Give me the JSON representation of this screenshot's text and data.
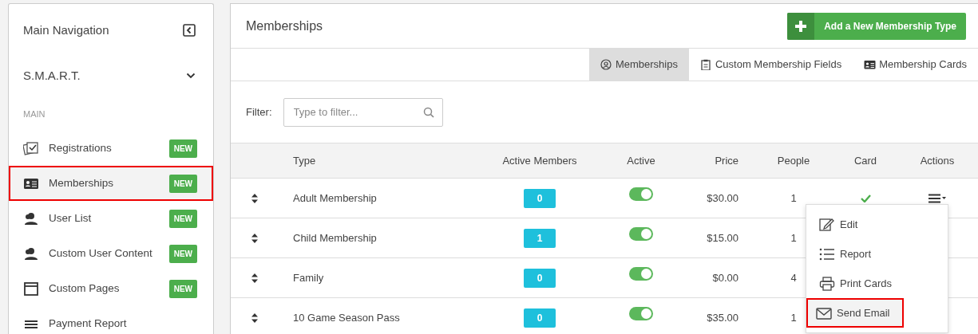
{
  "sidebar": {
    "title": "Main Navigation",
    "organization": "S.M.A.R.T.",
    "section_label": "MAIN",
    "items": [
      {
        "label": "Registrations",
        "badge": "NEW",
        "selected": false,
        "outlined": false
      },
      {
        "label": "Memberships",
        "badge": "NEW",
        "selected": true,
        "outlined": true
      },
      {
        "label": "User List",
        "badge": "NEW",
        "selected": false,
        "outlined": false
      },
      {
        "label": "Custom User Content",
        "badge": "NEW",
        "selected": false,
        "outlined": false
      },
      {
        "label": "Custom Pages",
        "badge": "NEW",
        "selected": false,
        "outlined": false
      },
      {
        "label": "Payment Report",
        "selected": false,
        "outlined": false
      }
    ]
  },
  "main": {
    "title": "Memberships",
    "add_button": "Add a New Membership Type",
    "tabs": [
      {
        "label": "Memberships",
        "selected": true
      },
      {
        "label": "Custom Membership Fields",
        "selected": false
      },
      {
        "label": "Membership Cards",
        "selected": false
      }
    ],
    "filter": {
      "label": "Filter:",
      "placeholder": "Type to filter..."
    },
    "table": {
      "columns": [
        "Type",
        "Active Members",
        "Active",
        "Price",
        "People",
        "Card",
        "Actions"
      ],
      "rows": [
        {
          "type": "Adult Membership",
          "active_members": "0",
          "active": true,
          "price": "$30.00",
          "people": "1",
          "card": true,
          "actions_menu": true
        },
        {
          "type": "Child Membership",
          "active_members": "1",
          "active": true,
          "price": "$15.00",
          "people": "1"
        },
        {
          "type": "Family",
          "active_members": "0",
          "active": true,
          "price": "$0.00",
          "people": "4"
        },
        {
          "type": "10 Game Season Pass",
          "active_members": "0",
          "active": true,
          "price": "$35.00",
          "people": "1"
        }
      ]
    },
    "actions_dropdown": {
      "items": [
        {
          "label": "Edit",
          "selected": false,
          "outlined": false
        },
        {
          "label": "Report",
          "selected": false,
          "outlined": false
        },
        {
          "label": "Print Cards",
          "selected": false,
          "outlined": false
        },
        {
          "label": "Send Email",
          "selected": true,
          "outlined": true
        }
      ]
    }
  }
}
